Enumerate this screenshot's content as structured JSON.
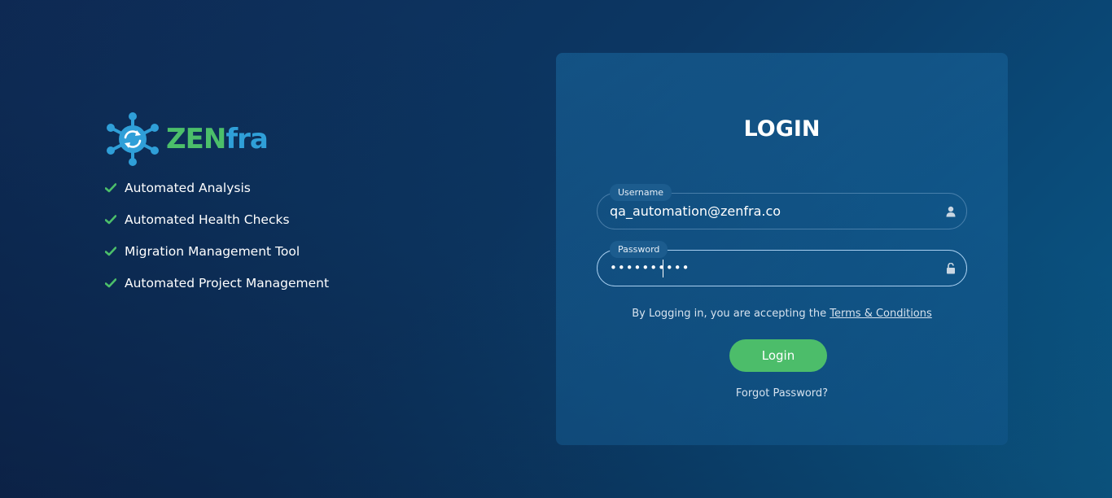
{
  "brand": {
    "name_part1": "ZEN",
    "name_part2": "fra",
    "logo_icon": "network-sync-icon",
    "colors": {
      "green": "#4cbf6a",
      "blue": "#2f9fd8"
    }
  },
  "features": [
    {
      "icon": "check-icon",
      "label": "Automated Analysis"
    },
    {
      "icon": "check-icon",
      "label": "Automated Health Checks"
    },
    {
      "icon": "check-icon",
      "label": "Migration Management Tool"
    },
    {
      "icon": "check-icon",
      "label": "Automated Project Management"
    }
  ],
  "login": {
    "title": "LOGIN",
    "username": {
      "label": "Username",
      "value": "qa_automation@zenfra.co",
      "icon": "user-icon"
    },
    "password": {
      "label": "Password",
      "value": "••••••••••",
      "icon": "unlock-icon"
    },
    "terms_prefix": "By Logging in, you are accepting the ",
    "terms_link": "Terms & Conditions",
    "button_label": "Login",
    "forgot_label": "Forgot Password?"
  },
  "colors": {
    "accent_green": "#4cbd6a",
    "bg_dark": "#0e2a55",
    "bg_light": "#0b5a86"
  }
}
